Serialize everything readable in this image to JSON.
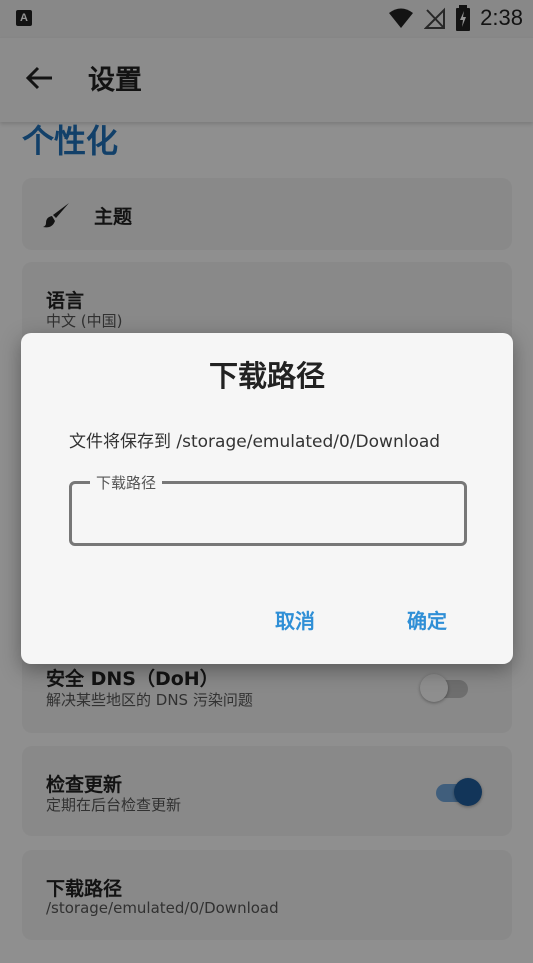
{
  "status_bar": {
    "left_icon": "A",
    "time": "2:38"
  },
  "app_bar": {
    "title": "设置"
  },
  "section": {
    "title": "个性化"
  },
  "settings": {
    "theme": {
      "title": "主题"
    },
    "language": {
      "title": "语言",
      "value": "中文 (中国)"
    },
    "doh": {
      "title": "安全 DNS（DoH）",
      "summary": "解决某些地区的 DNS 污染问题",
      "enabled": false
    },
    "update_check": {
      "title": "检查更新",
      "summary": "定期在后台检查更新",
      "enabled": true
    },
    "download_path": {
      "title": "下载路径",
      "value": "/storage/emulated/0/Download"
    }
  },
  "dialog": {
    "title": "下载路径",
    "message": "文件将保存到 /storage/emulated/0/Download",
    "field_label": "下载路径",
    "field_value": "",
    "cancel": "取消",
    "confirm": "确定"
  },
  "colors": {
    "accent": "#2f8fd6",
    "section": "#1f6fb6",
    "toggle_on": "#1f5c9a"
  }
}
